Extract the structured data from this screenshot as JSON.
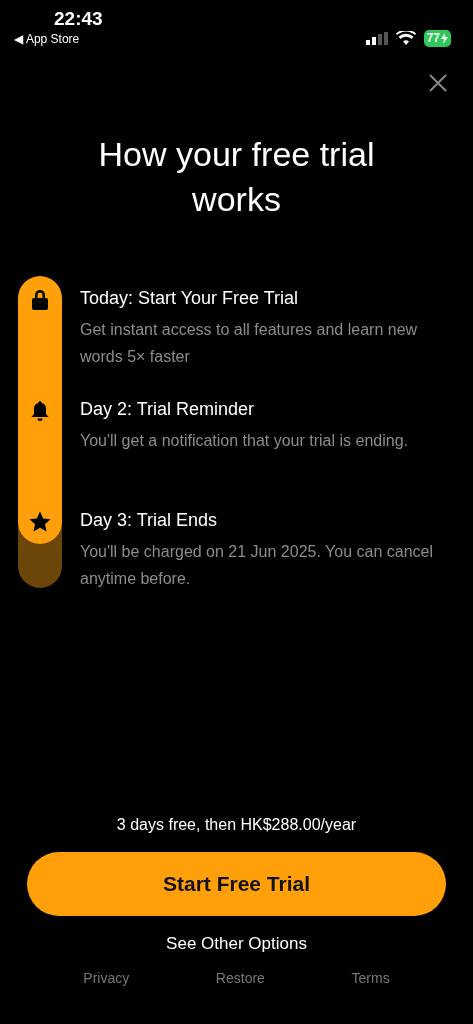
{
  "status_bar": {
    "time": "22:43",
    "back_label": "◀ App Store",
    "battery": "77"
  },
  "title": "How your free trial works",
  "timeline": {
    "level": 0.86,
    "items": [
      {
        "kind": "lock",
        "title": "Today: Start Your Free Trial",
        "description": "Get instant access to all features and learn new words 5× faster"
      },
      {
        "kind": "bell",
        "title": "Day 2: Trial Reminder",
        "description": "You'll get a notification that your trial is ending."
      },
      {
        "kind": "star",
        "title": "Day 3: Trial Ends",
        "description": "You'll be charged on 21 Jun 2025. You can cancel anytime before."
      }
    ]
  },
  "price_note": "3 days free, then HK$288.00/year",
  "primary_button": "Start Free Trial",
  "secondary_link": "See Other Options",
  "footer_links": [
    "Privacy",
    "Restore",
    "Terms"
  ]
}
